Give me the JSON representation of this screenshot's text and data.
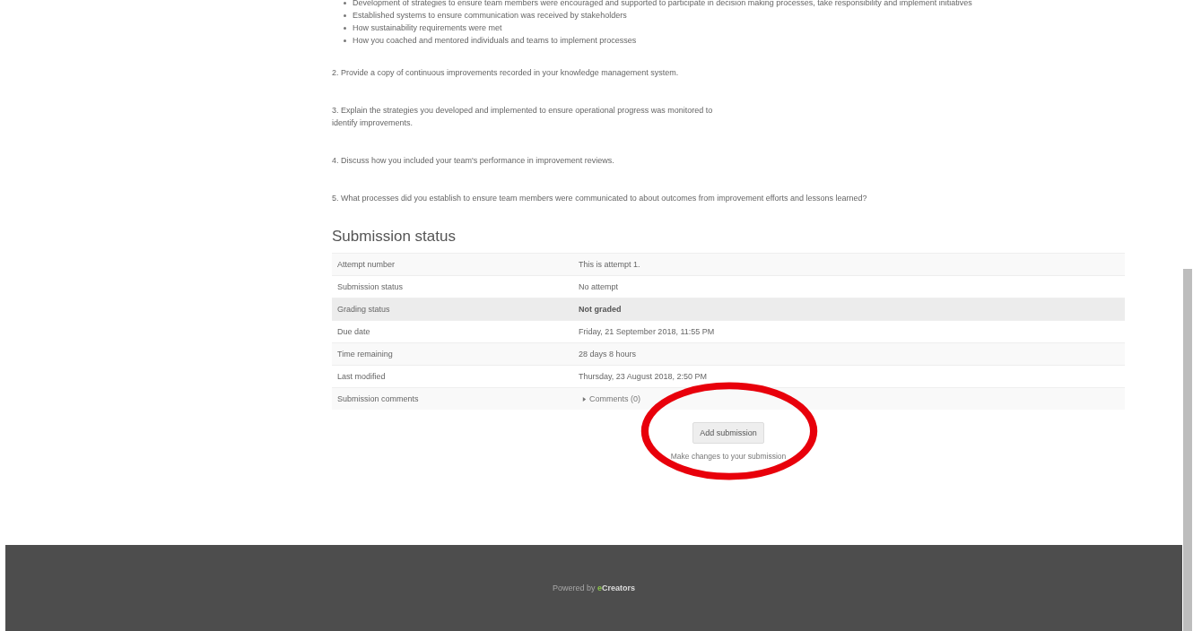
{
  "bullets": [
    "Development of strategies to ensure team members were encouraged and supported to participate in decision making processes, take responsibility and implement initiatives",
    "Established systems to ensure communication was received by stakeholders",
    "How sustainability requirements were met",
    "How you coached and mentored individuals and teams to implement processes"
  ],
  "questions": [
    {
      "text": "2. Provide a copy of continuous improvements recorded in your knowledge management system."
    },
    {
      "text": "3. Explain the strategies you developed and implemented to ensure operational progress was monitored to\nidentify improvements."
    },
    {
      "text": "4. Discuss how you included your team's performance in improvement reviews."
    },
    {
      "text": "5. What processes did you establish to ensure team members were communicated to about outcomes from improvement efforts and lessons learned?"
    }
  ],
  "submission_status": {
    "title": "Submission status",
    "rows": [
      {
        "label": "Attempt number",
        "value": "This is attempt 1.",
        "kind": "text",
        "highlighted": false
      },
      {
        "label": "Submission status",
        "value": "No attempt",
        "kind": "text",
        "highlighted": false
      },
      {
        "label": "Grading status",
        "value": "Not graded",
        "kind": "text",
        "highlighted": true
      },
      {
        "label": "Due date",
        "value": "Friday, 21 September 2018, 11:55 PM",
        "kind": "text",
        "highlighted": false
      },
      {
        "label": "Time remaining",
        "value": "28 days 8 hours",
        "kind": "text",
        "highlighted": false
      },
      {
        "label": "Last modified",
        "value": "Thursday, 23 August 2018, 2:50 PM",
        "kind": "text",
        "highlighted": false
      },
      {
        "label": "Submission comments",
        "value": "Comments (0)",
        "kind": "link",
        "highlighted": false
      }
    ]
  },
  "add_button": {
    "label": "Add submission"
  },
  "note": "Make changes to your submission",
  "footer": {
    "prefix": "Powered by",
    "brand_accent": "e",
    "brand_rest": "Creators"
  }
}
